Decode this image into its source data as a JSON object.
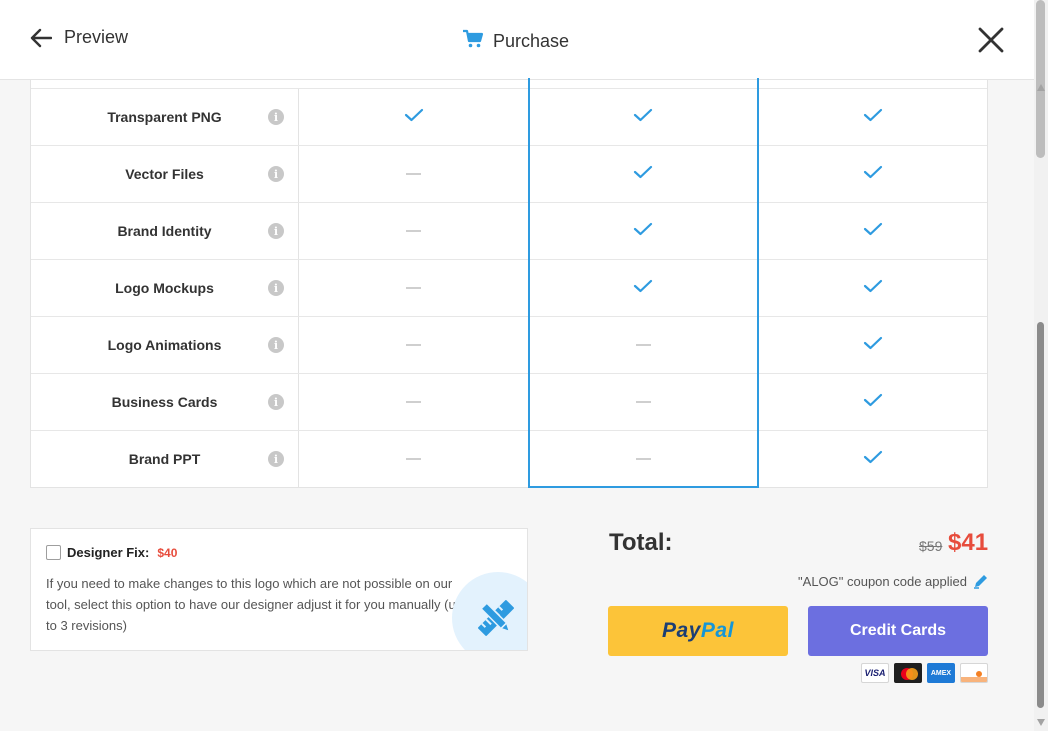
{
  "header": {
    "back_label": "Preview",
    "title": "Purchase"
  },
  "features": [
    {
      "name": "Transparent PNG",
      "plans": [
        true,
        true,
        true
      ]
    },
    {
      "name": "Vector Files",
      "plans": [
        false,
        true,
        true
      ]
    },
    {
      "name": "Brand Identity",
      "plans": [
        false,
        true,
        true
      ]
    },
    {
      "name": "Logo Mockups",
      "plans": [
        false,
        true,
        true
      ]
    },
    {
      "name": "Logo Animations",
      "plans": [
        false,
        false,
        true
      ]
    },
    {
      "name": "Business Cards",
      "plans": [
        false,
        false,
        true
      ]
    },
    {
      "name": "Brand PPT",
      "plans": [
        false,
        false,
        true
      ]
    }
  ],
  "highlighted_plan_index": 1,
  "designer_fix": {
    "label": "Designer Fix:",
    "price": "$40",
    "description": "If you need to make changes to this logo which are not possible on our tool, select this option to have our designer adjust it for you manually (up to 3 revisions)",
    "checked": false
  },
  "total": {
    "label": "Total:",
    "old_price": "$59",
    "new_price": "$41",
    "coupon_text": "\"ALOG\" coupon code applied"
  },
  "payment": {
    "paypal_part1": "Pay",
    "paypal_part2": "Pal",
    "credit_label": "Credit Cards",
    "cards": [
      "VISA",
      "MasterCard",
      "AMEX",
      "DISCOVER"
    ]
  },
  "colors": {
    "accent": "#2e9be0",
    "price_red": "#e74c3c",
    "paypal_yellow": "#fcc439",
    "credit_purple": "#6c6fe0",
    "check": "#2e9be0"
  },
  "icons": {
    "back": "arrow-left-icon",
    "cart": "cart-icon",
    "close": "close-icon",
    "info": "info-icon",
    "check": "check-icon",
    "dash": "dash-icon",
    "edit": "pencil-icon",
    "designer": "ruler-pencil-icon"
  }
}
